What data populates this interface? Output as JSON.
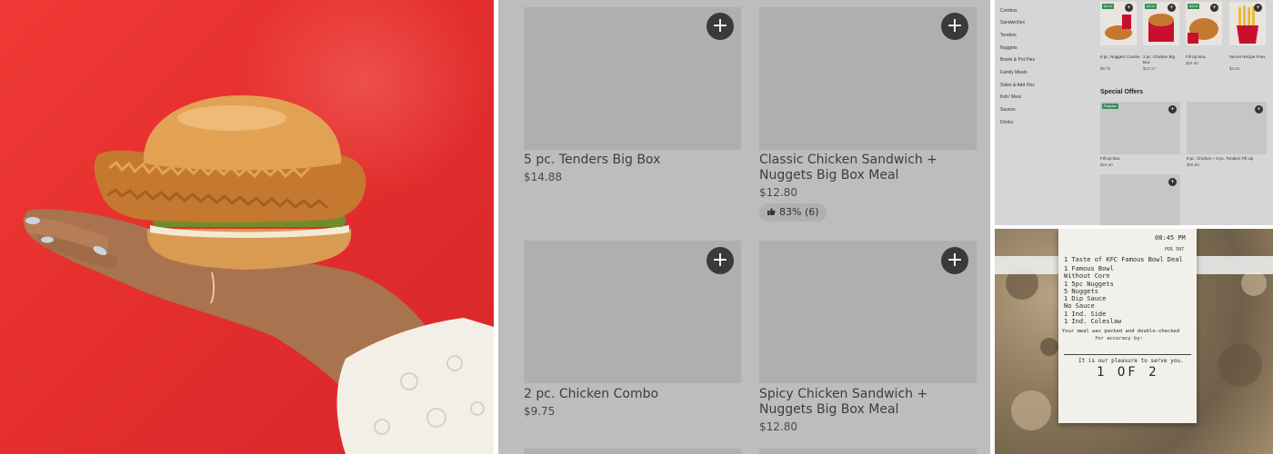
{
  "menu_grid": {
    "add_symbol": "+",
    "items": [
      {
        "name": "5 pc. Tenders Big Box",
        "price": "$14.88"
      },
      {
        "name": "Classic Chicken Sandwich + Nuggets Big Box Meal",
        "price": "$12.80",
        "rating": "83% (6)"
      },
      {
        "name": "2 pc. Chicken Combo",
        "price": "$9.75"
      },
      {
        "name": "Spicy Chicken Sandwich + Nuggets Big Box Meal",
        "price": "$12.80"
      }
    ]
  },
  "app_menu": {
    "categories": [
      "Combos",
      "Sandwiches",
      "Tenders",
      "Nuggets",
      "Bowls & Pot Pies",
      "Family Meals",
      "Sides & Add Ons",
      "Kids' Meal",
      "Sauces",
      "Drinks"
    ],
    "featured": [
      {
        "name": "8 pc. Nuggets Combo",
        "price": "$9.75",
        "badge": "#1 m"
      },
      {
        "name": "3 pc. Chicken Big Box",
        "price": "$13.17",
        "badge": "#2 m"
      },
      {
        "name": "Fill Up Box",
        "price": "$24.40",
        "badge": "#3 m"
      },
      {
        "name": "Secret Recipe Fries",
        "price": "$3.04",
        "badge": ""
      }
    ],
    "special_offers_title": "Special Offers",
    "offers": [
      {
        "name": "Fill Up Box",
        "price": "$24.40",
        "badge": "Popular"
      },
      {
        "name": "8 pc. Chicken + 8 pc. Tenders Fill Up",
        "price": "$36.60",
        "badge": ""
      },
      {
        "name": "",
        "price": "",
        "badge": ""
      }
    ]
  },
  "receipt": {
    "time": "08:45 PM",
    "pos": "POS 507",
    "lines": [
      "1 Taste of KFC Famous Bowl Deal",
      "  1 Famous Bowl",
      "    Without Corn",
      "1 5pc Nuggets",
      "  5 Nuggets",
      "  1 Dip Sauce",
      "    No Sauce",
      "1 Ind. Side",
      "  1 Ind. Coleslaw",
      "Your meal was packed and double-checked",
      "for accuracy by:",
      "It is our pleasure to serve you."
    ],
    "page": "1 OF 2"
  },
  "colors": {
    "photo_red": "#e42f2d",
    "grid_bg": "#bdbdbd",
    "tile_bg": "#afafaf",
    "add_button": "#3a3a3a",
    "badge_green": "#3a8f5a"
  },
  "icons": [
    "plus-icon",
    "thumbs-up-icon"
  ]
}
